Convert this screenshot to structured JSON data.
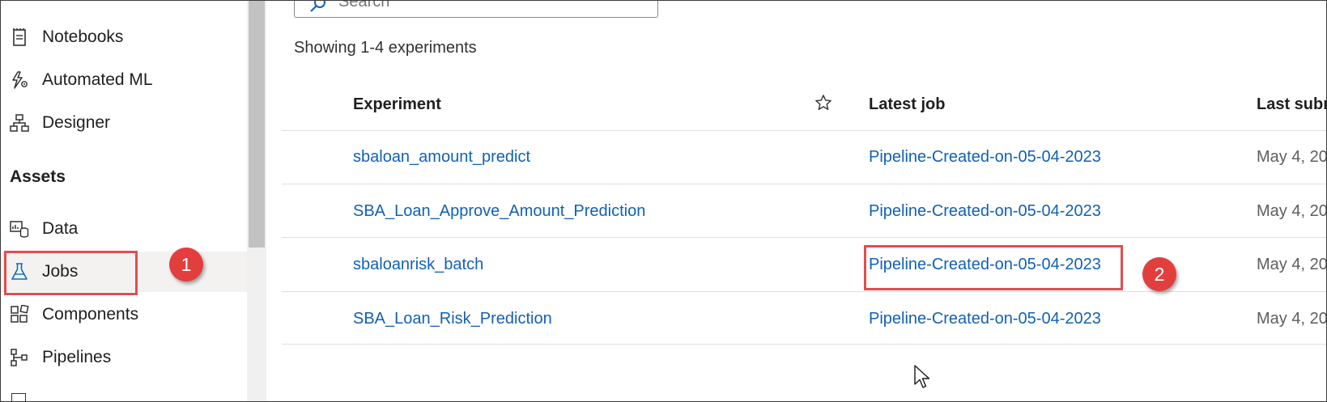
{
  "sidebar": {
    "items": [
      {
        "label": "Notebooks",
        "icon": "notebook-icon"
      },
      {
        "label": "Automated ML",
        "icon": "automated-ml-icon"
      },
      {
        "label": "Designer",
        "icon": "designer-icon"
      }
    ],
    "section_title": "Assets",
    "asset_items": [
      {
        "label": "Data",
        "icon": "data-icon"
      },
      {
        "label": "Jobs",
        "icon": "jobs-flask-icon",
        "active": true
      },
      {
        "label": "Components",
        "icon": "components-icon"
      },
      {
        "label": "Pipelines",
        "icon": "pipelines-icon"
      }
    ]
  },
  "main": {
    "search": {
      "placeholder": "Search"
    },
    "showing_text": "Showing 1-4 experiments",
    "table": {
      "columns": [
        "Experiment",
        "Latest job",
        "Last subm"
      ],
      "rows": [
        {
          "experiment": "sbaloan_amount_predict",
          "latest_job": "Pipeline-Created-on-05-04-2023",
          "last_submitted": "May 4, 20"
        },
        {
          "experiment": "SBA_Loan_Approve_Amount_Prediction",
          "latest_job": "Pipeline-Created-on-05-04-2023",
          "last_submitted": "May 4, 20"
        },
        {
          "experiment": "sbaloanrisk_batch",
          "latest_job": "Pipeline-Created-on-05-04-2023",
          "last_submitted": "May 4, 20"
        },
        {
          "experiment": "SBA_Loan_Risk_Prediction",
          "latest_job": "Pipeline-Created-on-05-04-2023",
          "last_submitted": "May 4, 20"
        }
      ]
    }
  },
  "annotations": {
    "badge_1": "1",
    "badge_2": "2"
  },
  "colors": {
    "link": "#1160b7",
    "callout": "#e04e50",
    "badge": "#e23e3e"
  }
}
